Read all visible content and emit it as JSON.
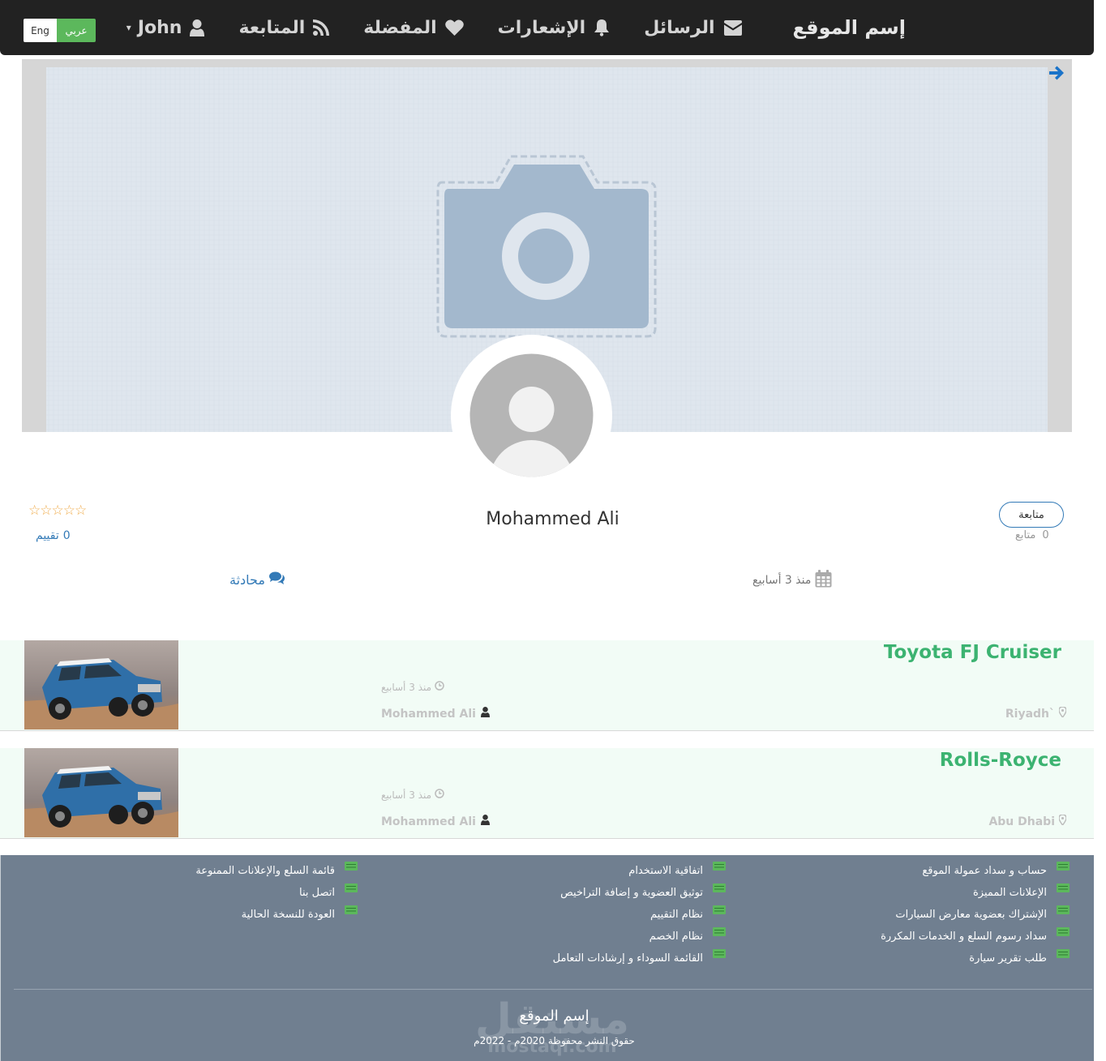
{
  "navbar": {
    "brand": "إسم الموقع",
    "messages": "الرسائل",
    "notifications": "الإشعارات",
    "favorites": "المفضلة",
    "following": "المتابعة",
    "user": "John",
    "lang_en": "Eng",
    "lang_ar": "عربي"
  },
  "profile": {
    "name": "Mohammed Ali",
    "stars": "☆☆☆☆☆",
    "rating_count": "0",
    "rating_label": "تقييم",
    "follow_button": "متابعة",
    "followers_count": "0",
    "followers_label": "متابع",
    "joined": "منذ 3 أسابيع",
    "chat": "محادثة"
  },
  "listings": [
    {
      "title": "Toyota FJ Cruiser",
      "time": "منذ 3 أسابيع",
      "author": "Mohammed Ali",
      "location": "Riyadh`"
    },
    {
      "title": "Rolls-Royce",
      "time": "منذ 3 أسابيع",
      "author": "Mohammed Ali",
      "location": "Abu Dhabi"
    }
  ],
  "footer": {
    "col1": [
      "حساب و سداد عمولة الموقع",
      "الإعلانات المميزة",
      "الإشتراك بعضوية معارض السيارات",
      "سداد رسوم السلع و الخدمات المكررة",
      "طلب تقرير سيارة"
    ],
    "col2": [
      "اتفاقية الاستخدام",
      "توثيق العضوية و إضافة التراخيص",
      "نظام التقييم",
      "نظام الخصم",
      "القائمة السوداء و إرشادات التعامل"
    ],
    "col3": [
      "قائمة السلع والإعلانات الممنوعة",
      "اتصل بنا",
      "العودة للنسخة الحالية"
    ],
    "site_name": "إسم الموقع",
    "copyright": "حقوق النشر محفوظة 2020م - 2022م",
    "watermark": "مستقل",
    "watermark_sub": "mostaql.com"
  },
  "colors": {
    "navbar": "#222222",
    "accent_green": "#3cb371",
    "link_blue": "#337ab7",
    "footer_bg": "#707f90",
    "star": "#f0ad4e"
  },
  "icons": [
    "user-icon",
    "rss-icon",
    "heart-icon",
    "bell-icon",
    "envelope-icon",
    "arrow-right-icon",
    "calendar-icon",
    "comments-icon",
    "clock-icon",
    "map-marker-icon",
    "list-icon"
  ]
}
